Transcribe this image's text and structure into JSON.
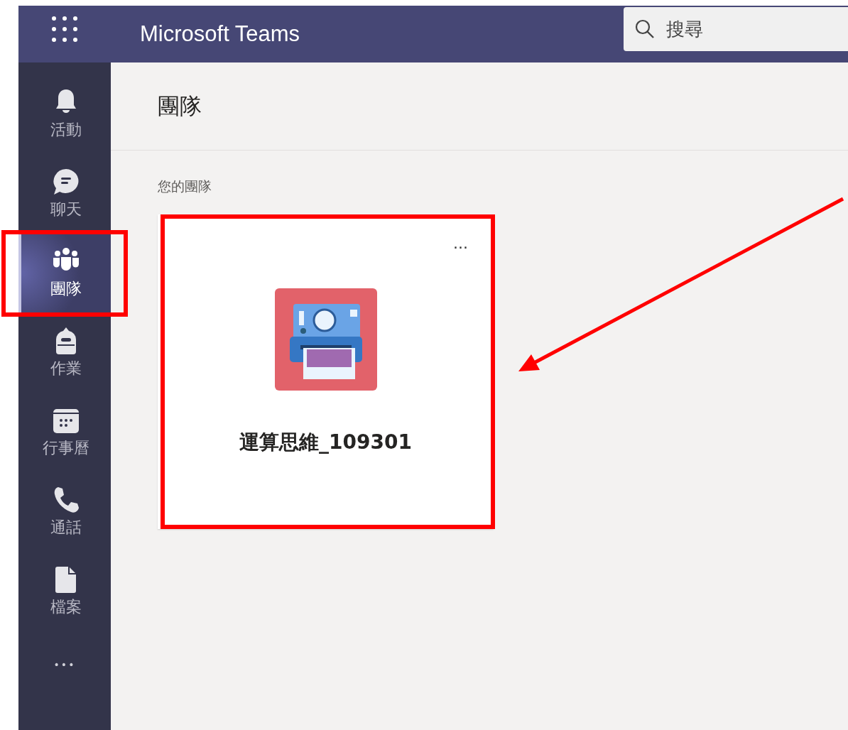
{
  "app": {
    "title": "Microsoft Teams"
  },
  "search": {
    "placeholder": "搜尋"
  },
  "nav_items": [
    {
      "kind": "bell",
      "label": "活動",
      "selected": false,
      "highlighted": false
    },
    {
      "kind": "chat",
      "label": "聊天",
      "selected": false,
      "highlighted": false
    },
    {
      "kind": "teams",
      "label": "團隊",
      "selected": true,
      "highlighted": true
    },
    {
      "kind": "assignments",
      "label": "作業",
      "selected": false,
      "highlighted": false
    },
    {
      "kind": "calendar",
      "label": "行事曆",
      "selected": false,
      "highlighted": false
    },
    {
      "kind": "calls",
      "label": "通話",
      "selected": false,
      "highlighted": false
    },
    {
      "kind": "files",
      "label": "檔案",
      "selected": false,
      "highlighted": false
    }
  ],
  "nav_more": "•••",
  "page_title": "團隊",
  "section_label": "您的團隊",
  "teams": [
    {
      "name": "運算思維_109301",
      "more": "···",
      "highlighted": true,
      "pointer_arrow": true
    }
  ]
}
